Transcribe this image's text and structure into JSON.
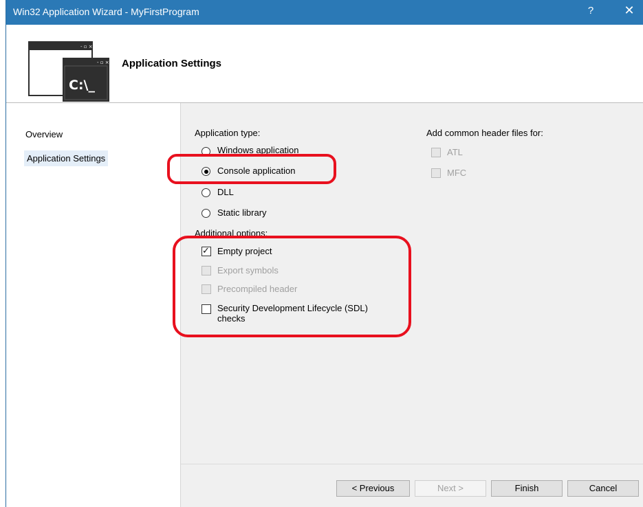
{
  "window": {
    "title": "Win32 Application Wizard - MyFirstProgram",
    "help": "?",
    "close": "✕"
  },
  "header": {
    "title": "Application Settings",
    "icon_prompt": "C:\\_"
  },
  "nav": {
    "items": [
      {
        "label": "Overview"
      },
      {
        "label": "Application Settings"
      }
    ]
  },
  "application_type": {
    "label": "Application type:",
    "options": [
      {
        "label": "Windows application",
        "selected": false
      },
      {
        "label": "Console application",
        "selected": true
      },
      {
        "label": "DLL",
        "selected": false
      },
      {
        "label": "Static library",
        "selected": false
      }
    ]
  },
  "additional_options": {
    "label": "Additional options:",
    "items": [
      {
        "label": "Empty project",
        "checked": true,
        "enabled": true
      },
      {
        "label": "Export symbols",
        "checked": false,
        "enabled": false
      },
      {
        "label": "Precompiled header",
        "checked": false,
        "enabled": false
      },
      {
        "label": "Security Development Lifecycle (SDL)",
        "label2": "checks",
        "checked": false,
        "enabled": true
      }
    ]
  },
  "common_headers": {
    "label": "Add common header files for:",
    "items": [
      {
        "label": "ATL",
        "checked": false,
        "enabled": false
      },
      {
        "label": "MFC",
        "checked": false,
        "enabled": false
      }
    ]
  },
  "buttons": {
    "previous": "< Previous",
    "next": "Next >",
    "finish": "Finish",
    "cancel": "Cancel"
  },
  "colors": {
    "titlebar": "#2b79b6",
    "highlight": "#e8101e",
    "content_bg": "#f0f0f0"
  }
}
